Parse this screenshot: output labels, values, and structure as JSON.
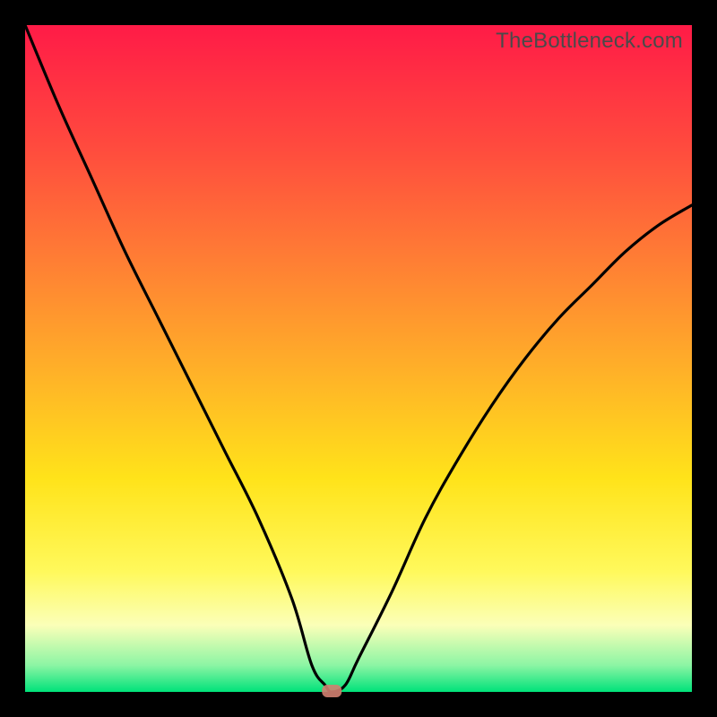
{
  "watermark": "TheBottleneck.com",
  "chart_data": {
    "type": "line",
    "title": "",
    "xlabel": "",
    "ylabel": "",
    "xlim": [
      0,
      100
    ],
    "ylim": [
      0,
      100
    ],
    "grid": false,
    "legend": false,
    "series": [
      {
        "name": "bottleneck-curve",
        "x": [
          0,
          5,
          10,
          15,
          20,
          25,
          30,
          35,
          40,
          43,
          45,
          46,
          48,
          50,
          55,
          60,
          65,
          70,
          75,
          80,
          85,
          90,
          95,
          100
        ],
        "y": [
          100,
          88,
          77,
          66,
          56,
          46,
          36,
          26,
          14,
          4,
          1,
          0,
          1,
          5,
          15,
          26,
          35,
          43,
          50,
          56,
          61,
          66,
          70,
          73
        ]
      }
    ],
    "marker": {
      "x": 46,
      "y": 0,
      "color": "#d08070"
    },
    "background_gradient": {
      "top": "#ff1b47",
      "bottom": "#00e27a"
    }
  }
}
